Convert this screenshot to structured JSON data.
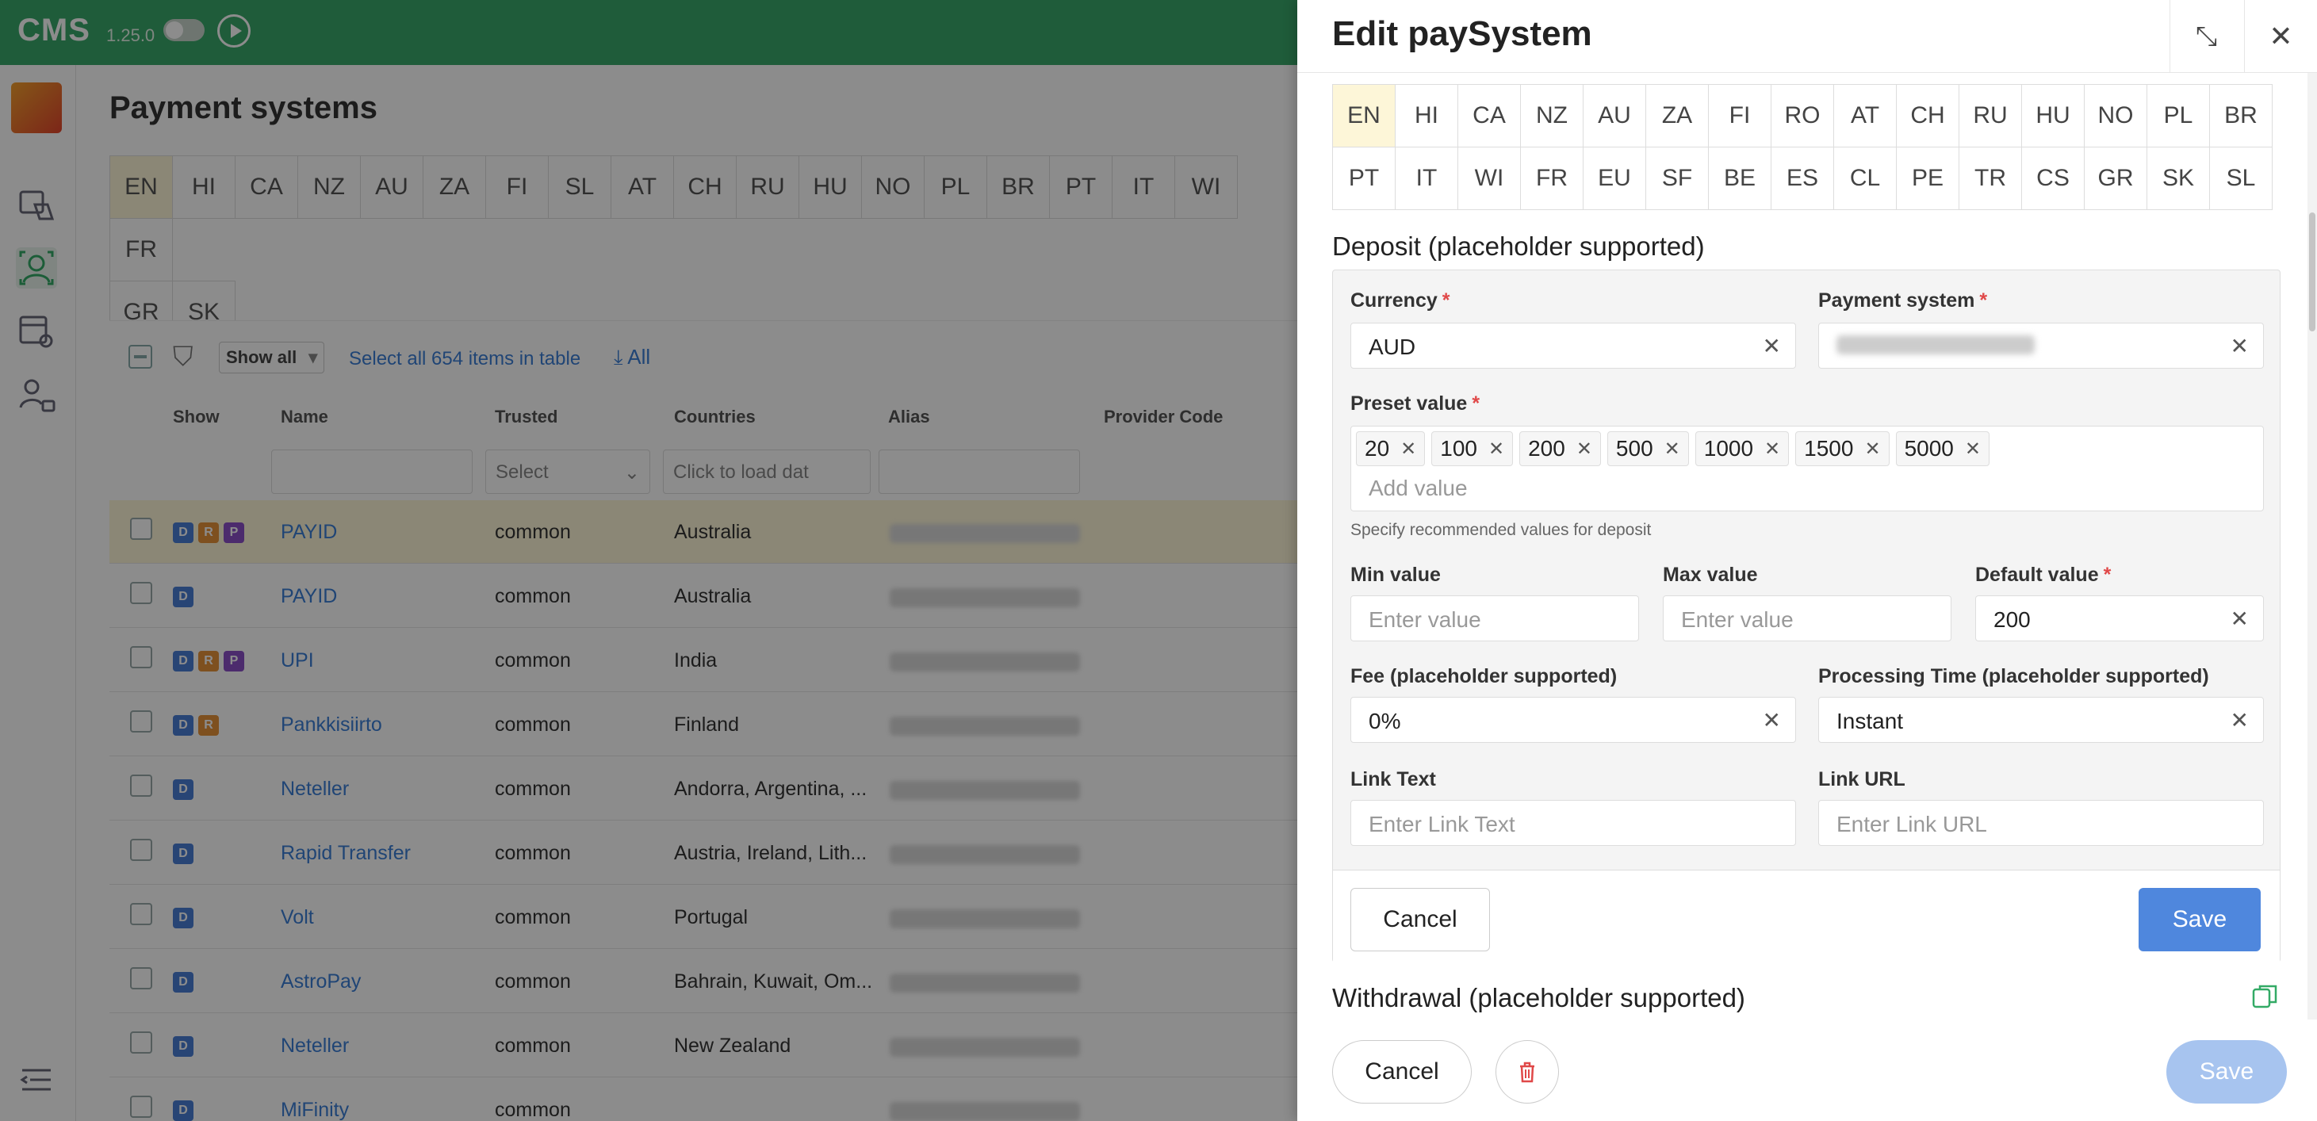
{
  "app": {
    "logo": "CMS",
    "version": "1.25.0"
  },
  "page": {
    "title": "Payment systems",
    "languages_row1": [
      "EN",
      "HI",
      "CA",
      "NZ",
      "AU",
      "ZA",
      "FI",
      "SL",
      "AT",
      "CH",
      "RU",
      "HU",
      "NO",
      "PL",
      "BR",
      "PT",
      "IT",
      "WI",
      "FR"
    ],
    "languages_row2": [
      "GR",
      "SK"
    ],
    "selected_language": "EN"
  },
  "table": {
    "show_filter": "Show all",
    "select_all": "Select all 654 items in table",
    "export_all": "All",
    "columns": [
      "Show",
      "Name",
      "Trusted",
      "Countries",
      "Alias",
      "Provider Code"
    ],
    "filter_placeholders": {
      "trusted": "Select",
      "countries": "Click to load dat"
    },
    "rows": [
      {
        "badges": [
          "D",
          "R",
          "P"
        ],
        "name": "PAYID",
        "trusted": "common",
        "countries": "Australia",
        "highlight": true
      },
      {
        "badges": [
          "D"
        ],
        "name": "PAYID",
        "trusted": "common",
        "countries": "Australia",
        "highlight": false
      },
      {
        "badges": [
          "D",
          "R",
          "P"
        ],
        "name": "UPI",
        "trusted": "common",
        "countries": "India",
        "highlight": false
      },
      {
        "badges": [
          "D",
          "R"
        ],
        "name": "Pankkisiirto",
        "trusted": "common",
        "countries": "Finland",
        "highlight": false
      },
      {
        "badges": [
          "D"
        ],
        "name": "Neteller",
        "trusted": "common",
        "countries": "Andorra, Argentina, ...",
        "highlight": false
      },
      {
        "badges": [
          "D"
        ],
        "name": "Rapid Transfer",
        "trusted": "common",
        "countries": "Austria, Ireland, Lith...",
        "highlight": false
      },
      {
        "badges": [
          "D"
        ],
        "name": "Volt",
        "trusted": "common",
        "countries": "Portugal",
        "highlight": false
      },
      {
        "badges": [
          "D"
        ],
        "name": "AstroPay",
        "trusted": "common",
        "countries": "Bahrain, Kuwait, Om...",
        "highlight": false
      },
      {
        "badges": [
          "D"
        ],
        "name": "Neteller",
        "trusted": "common",
        "countries": "New Zealand",
        "highlight": false
      },
      {
        "badges": [
          "D"
        ],
        "name": "MiFinity",
        "trusted": "common",
        "countries": "",
        "highlight": false
      }
    ]
  },
  "drawer": {
    "title": "Edit paySystem",
    "languages_row1": [
      "EN",
      "HI",
      "CA",
      "NZ",
      "AU",
      "ZA",
      "FI",
      "RO",
      "AT",
      "CH",
      "RU",
      "HU",
      "NO",
      "PL",
      "BR"
    ],
    "languages_row2": [
      "PT",
      "IT",
      "WI",
      "FR",
      "EU",
      "SF",
      "BE",
      "ES",
      "CL",
      "PE",
      "TR",
      "CS",
      "GR",
      "SK",
      "SL"
    ],
    "selected_language": "EN",
    "deposit": {
      "section_title": "Deposit (placeholder supported)",
      "currency_label": "Currency",
      "currency_value": "AUD",
      "payment_system_label": "Payment system",
      "preset_label": "Preset value",
      "preset_values": [
        "20",
        "100",
        "200",
        "500",
        "1000",
        "1500",
        "5000"
      ],
      "preset_placeholder": "Add value",
      "preset_hint": "Specify recommended values for deposit",
      "min_label": "Min value",
      "min_placeholder": "Enter value",
      "max_label": "Max value",
      "max_placeholder": "Enter value",
      "default_label": "Default value",
      "default_value": "200",
      "fee_label": "Fee (placeholder supported)",
      "fee_value": "0%",
      "processing_label": "Processing Time (placeholder supported)",
      "processing_value": "Instant",
      "link_text_label": "Link Text",
      "link_text_placeholder": "Enter Link Text",
      "link_url_label": "Link URL",
      "link_url_placeholder": "Enter Link URL",
      "cancel": "Cancel",
      "save": "Save"
    },
    "withdrawal": {
      "section_title": "Withdrawal (placeholder supported)"
    },
    "footer": {
      "cancel": "Cancel",
      "save": "Save"
    }
  }
}
